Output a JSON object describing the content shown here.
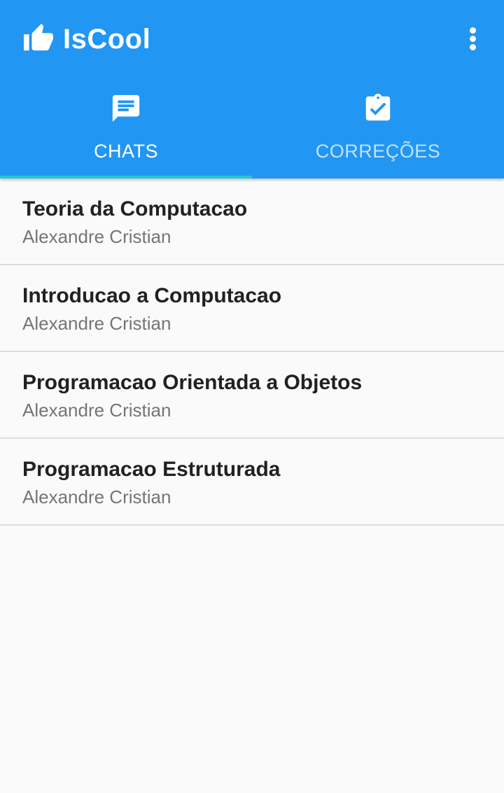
{
  "app": {
    "title": "IsCool",
    "logo_icon": "thumb-up-icon",
    "menu_icon": "more-vert-icon"
  },
  "colors": {
    "primary": "#2196f3",
    "tab_indicator": "#26c6da",
    "background": "#fafafa",
    "title_text": "#212121",
    "subtitle_text": "#757575"
  },
  "tabs": [
    {
      "label": "CHATS",
      "icon": "chat-icon",
      "active": true
    },
    {
      "label": "CORREÇÕES",
      "icon": "clipboard-check-icon",
      "active": false
    }
  ],
  "chats": [
    {
      "title": "Teoria da Computacao",
      "subtitle": "Alexandre Cristian"
    },
    {
      "title": "Introducao a Computacao",
      "subtitle": "Alexandre Cristian"
    },
    {
      "title": "Programacao Orientada a Objetos",
      "subtitle": "Alexandre Cristian"
    },
    {
      "title": "Programacao Estruturada",
      "subtitle": "Alexandre Cristian"
    }
  ]
}
